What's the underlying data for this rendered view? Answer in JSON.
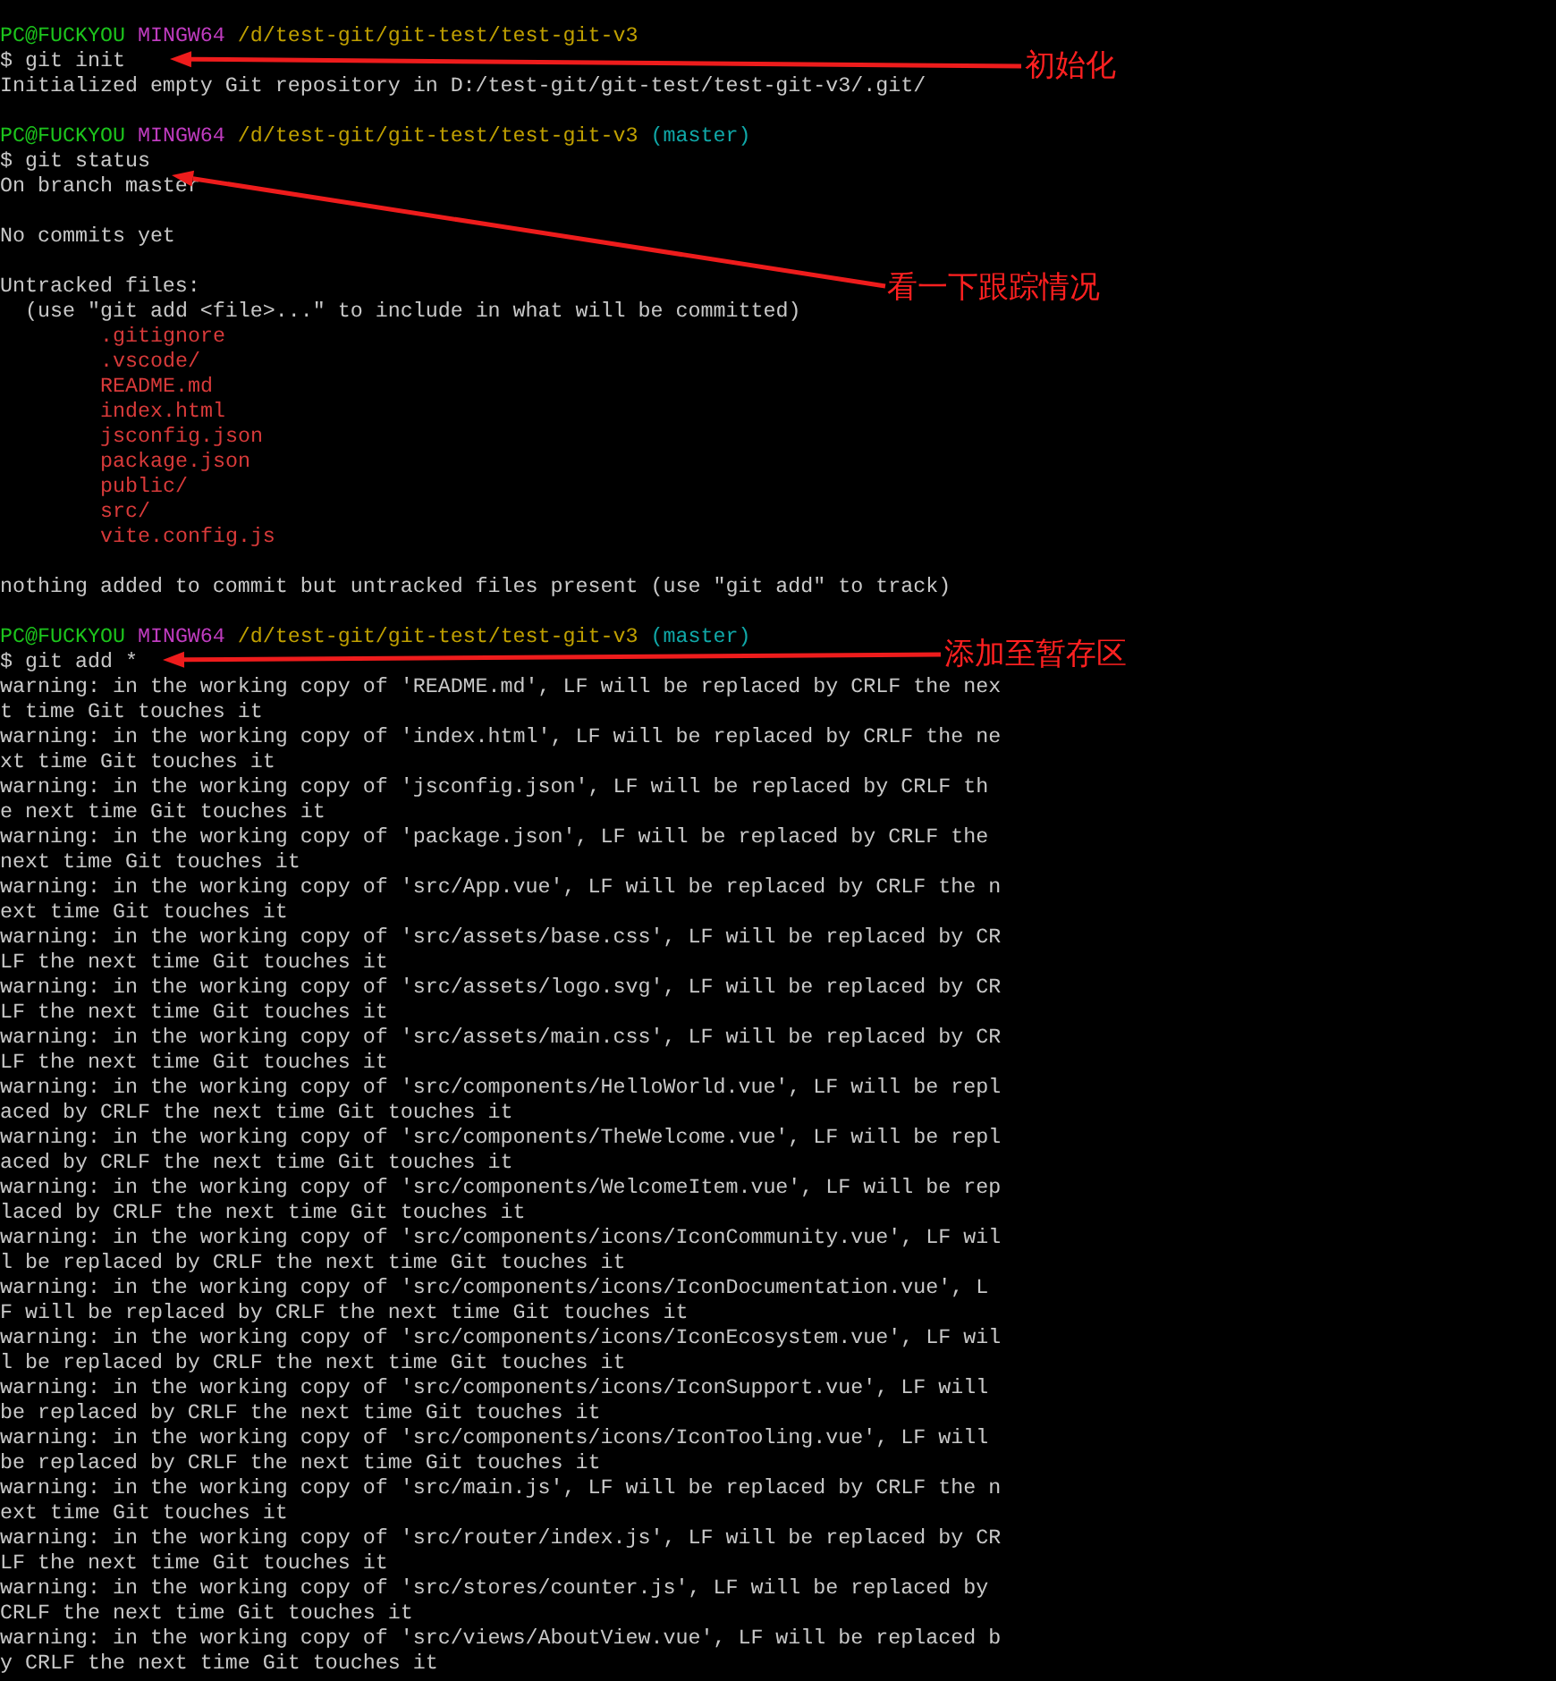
{
  "terminal": {
    "lines": [
      {
        "kind": "prompt",
        "user": "PC@FUCKYOU",
        "system": "MINGW64",
        "path": "/d/test-git/git-test/test-git-v3"
      },
      {
        "kind": "command",
        "text": "$ git init"
      },
      {
        "kind": "output",
        "text": "Initialized empty Git repository in D:/test-git/git-test/test-git-v3/.git/"
      },
      {
        "kind": "blank"
      },
      {
        "kind": "prompt",
        "user": "PC@FUCKYOU",
        "system": "MINGW64",
        "path": "/d/test-git/git-test/test-git-v3",
        "branch": "(master)"
      },
      {
        "kind": "command",
        "text": "$ git status"
      },
      {
        "kind": "output",
        "text": "On branch master"
      },
      {
        "kind": "blank"
      },
      {
        "kind": "output",
        "text": "No commits yet"
      },
      {
        "kind": "blank"
      },
      {
        "kind": "output",
        "text": "Untracked files:"
      },
      {
        "kind": "output",
        "text": "  (use \"git add <file>...\" to include in what will be committed)"
      },
      {
        "kind": "file",
        "text": ".gitignore"
      },
      {
        "kind": "file",
        "text": ".vscode/"
      },
      {
        "kind": "file",
        "text": "README.md"
      },
      {
        "kind": "file",
        "text": "index.html"
      },
      {
        "kind": "file",
        "text": "jsconfig.json"
      },
      {
        "kind": "file",
        "text": "package.json"
      },
      {
        "kind": "file",
        "text": "public/"
      },
      {
        "kind": "file",
        "text": "src/"
      },
      {
        "kind": "file",
        "text": "vite.config.js"
      },
      {
        "kind": "blank"
      },
      {
        "kind": "output",
        "text": "nothing added to commit but untracked files present (use \"git add\" to track)"
      },
      {
        "kind": "blank"
      },
      {
        "kind": "prompt",
        "user": "PC@FUCKYOU",
        "system": "MINGW64",
        "path": "/d/test-git/git-test/test-git-v3",
        "branch": "(master)"
      },
      {
        "kind": "command",
        "text": "$ git add *"
      },
      {
        "kind": "output",
        "text": "warning: in the working copy of 'README.md', LF will be replaced by CRLF the next time Git touches it"
      },
      {
        "kind": "output",
        "text": "warning: in the working copy of 'index.html', LF will be replaced by CRLF the next time Git touches it"
      },
      {
        "kind": "output",
        "text": "warning: in the working copy of 'jsconfig.json', LF will be replaced by CRLF the next time Git touches it"
      },
      {
        "kind": "output",
        "text": "warning: in the working copy of 'package.json', LF will be replaced by CRLF the next time Git touches it"
      },
      {
        "kind": "output",
        "text": "warning: in the working copy of 'src/App.vue', LF will be replaced by CRLF the next time Git touches it"
      },
      {
        "kind": "output",
        "text": "warning: in the working copy of 'src/assets/base.css', LF will be replaced by CRLF the next time Git touches it"
      },
      {
        "kind": "output",
        "text": "warning: in the working copy of 'src/assets/logo.svg', LF will be replaced by CRLF the next time Git touches it"
      },
      {
        "kind": "output",
        "text": "warning: in the working copy of 'src/assets/main.css', LF will be replaced by CRLF the next time Git touches it"
      },
      {
        "kind": "output",
        "text": "warning: in the working copy of 'src/components/HelloWorld.vue', LF will be replaced by CRLF the next time Git touches it"
      },
      {
        "kind": "output",
        "text": "warning: in the working copy of 'src/components/TheWelcome.vue', LF will be replaced by CRLF the next time Git touches it"
      },
      {
        "kind": "output",
        "text": "warning: in the working copy of 'src/components/WelcomeItem.vue', LF will be replaced by CRLF the next time Git touches it"
      },
      {
        "kind": "output",
        "text": "warning: in the working copy of 'src/components/icons/IconCommunity.vue', LF will be replaced by CRLF the next time Git touches it"
      },
      {
        "kind": "output",
        "text": "warning: in the working copy of 'src/components/icons/IconDocumentation.vue', LF will be replaced by CRLF the next time Git touches it"
      },
      {
        "kind": "output",
        "text": "warning: in the working copy of 'src/components/icons/IconEcosystem.vue', LF will be replaced by CRLF the next time Git touches it"
      },
      {
        "kind": "output",
        "text": "warning: in the working copy of 'src/components/icons/IconSupport.vue', LF will be replaced by CRLF the next time Git touches it"
      },
      {
        "kind": "output",
        "text": "warning: in the working copy of 'src/components/icons/IconTooling.vue', LF will be replaced by CRLF the next time Git touches it"
      },
      {
        "kind": "output",
        "text": "warning: in the working copy of 'src/main.js', LF will be replaced by CRLF the next time Git touches it"
      },
      {
        "kind": "output",
        "text": "warning: in the working copy of 'src/router/index.js', LF will be replaced by CRLF the next time Git touches it"
      },
      {
        "kind": "output",
        "text": "warning: in the working copy of 'src/stores/counter.js', LF will be replaced by CRLF the next time Git touches it"
      },
      {
        "kind": "output",
        "text": "warning: in the working copy of 'src/views/AboutView.vue', LF will be replaced by CRLF the next time Git touches it"
      }
    ]
  },
  "annotations": [
    {
      "label": "初始化"
    },
    {
      "label": "看一下跟踪情况"
    },
    {
      "label": "添加至暂存区"
    }
  ]
}
